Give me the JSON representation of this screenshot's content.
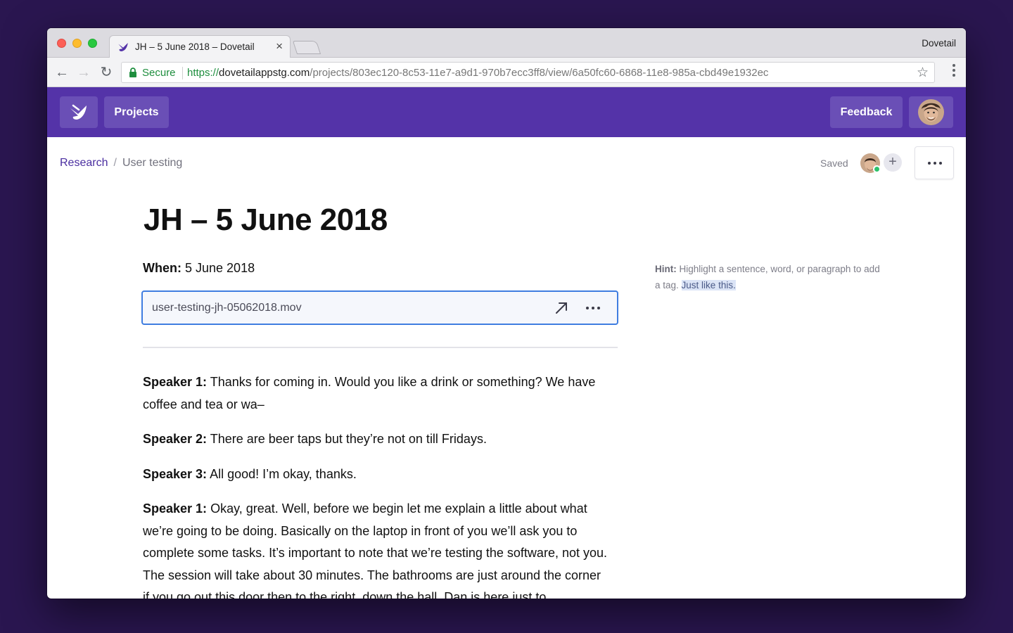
{
  "browser": {
    "tab_title": "JH – 5 June 2018 – Dovetail",
    "tab_close": "×",
    "profile_name": "Dovetail",
    "secure_label": "Secure",
    "url_scheme": "https://",
    "url_host": "dovetailappstg.com",
    "url_path": "/projects/803ec120-8c53-11e7-a9d1-970b7ecc3ff8/view/6a50fc60-6868-11e8-985a-cbd49e1932ec",
    "back_icon": "←",
    "forward_icon": "→",
    "reload_icon": "↻",
    "star_icon": "☆"
  },
  "appbar": {
    "projects_label": "Projects",
    "feedback_label": "Feedback",
    "brand_color": "#5433a8"
  },
  "breadcrumb": {
    "parent": "Research",
    "separator": "/",
    "current": "User testing"
  },
  "status": {
    "saved_label": "Saved",
    "add_collaborator": "+"
  },
  "document": {
    "title": "JH – 5 June 2018",
    "when_label": "When:",
    "when_value": "5 June 2018",
    "attachment_name": "user-testing-jh-05062018.mov"
  },
  "transcript": [
    {
      "speaker": "Speaker 1:",
      "text": "Thanks for coming in. Would you like a drink or something? We have coffee and tea or wa–"
    },
    {
      "speaker": "Speaker 2:",
      "text": "There are beer taps but they’re not on till Fridays."
    },
    {
      "speaker": "Speaker 3:",
      "text": "All good! I’m okay, thanks."
    },
    {
      "speaker": "Speaker 1:",
      "text": "Okay, great. Well, before we begin let me explain a little about what we’re going to be doing. Basically on the laptop in front of you we’ll ask you to complete some tasks. It’s important to note that we’re testing the software, not you. The session will take about 30 minutes. The bathrooms are just around the corner if you go out this door then to the right, down the hall. Dan is here just to"
    }
  ],
  "hint": {
    "label": "Hint:",
    "text": "Highlight a sentence, word, or paragraph to add a tag.",
    "example": "Just like this."
  }
}
